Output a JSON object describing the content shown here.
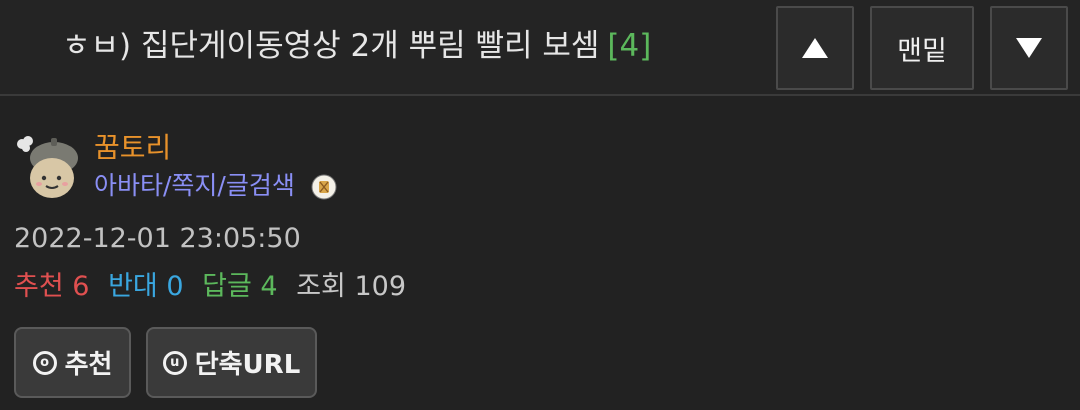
{
  "header": {
    "title": "ㅎㅂ) 집단게이동영상 2개 뿌림 빨리 보셈",
    "reply_count": "[4]",
    "up_icon": "up-triangle-icon",
    "bottom_label": "맨밑",
    "down_icon": "down-triangle-icon"
  },
  "author": {
    "avatar_icon": "acorn-avatar",
    "nickname": "꿈토리",
    "links": "아바타/쪽지/글검색",
    "badge_icon": "level-badge-icon"
  },
  "post": {
    "datetime": "2022-12-01 23:05:50"
  },
  "stats": {
    "recommend_label": "추천",
    "recommend_value": "6",
    "oppose_label": "반대",
    "oppose_value": "0",
    "reply_label": "답글",
    "reply_value": "4",
    "view_label": "조회",
    "view_value": "109"
  },
  "actions": {
    "recommend_icon_char": "o",
    "recommend_label": "추천",
    "shorturl_icon_char": "u",
    "shorturl_label": "단축URL"
  },
  "colors": {
    "background": "#222222",
    "nickname": "#e8922b",
    "links": "#8a8ff5",
    "recommend": "#e05050",
    "oppose": "#3aa7e0",
    "reply": "#5cb85c"
  }
}
